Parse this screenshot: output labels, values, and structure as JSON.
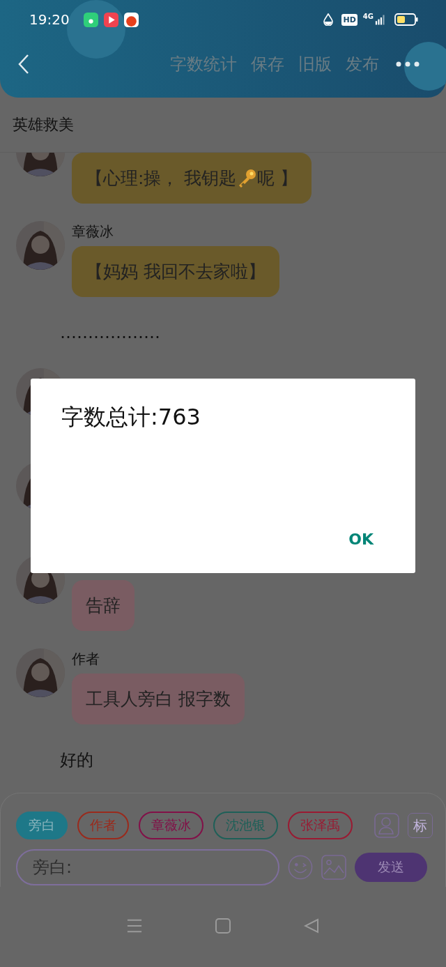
{
  "status_bar": {
    "time": "19:20",
    "hd": "HD",
    "network": "4G"
  },
  "header": {
    "actions": [
      "字数统计",
      "保存",
      "旧版",
      "发布"
    ]
  },
  "title": "英雄救美",
  "messages": [
    {
      "kind": "bubble",
      "color": "#6a5a2a",
      "segments": [
        {
          "kind": "text",
          "text": "【心理:操，  我钥匙"
        },
        {
          "kind": "key"
        },
        {
          "kind": "text",
          "text": "呢 】"
        }
      ]
    },
    {
      "kind": "bubble",
      "name": "章薇冰",
      "color": "#6a5a2a",
      "segments": [
        {
          "kind": "text",
          "text": "【妈妈 我回不去家啦】"
        }
      ]
    },
    {
      "kind": "narration",
      "text": "………………"
    },
    {
      "kind": "bubble"
    },
    {
      "kind": "bubble"
    },
    {
      "kind": "bubble",
      "color": "#7a5c62",
      "segments": [
        {
          "kind": "text",
          "text": "告辞"
        }
      ]
    },
    {
      "kind": "bubble",
      "name": "作者",
      "color": "#7a5c62",
      "segments": [
        {
          "kind": "text",
          "text": "工具人旁白 报字数"
        }
      ]
    },
    {
      "kind": "narration",
      "text": "好的"
    }
  ],
  "composer": {
    "roles": [
      {
        "label": "旁白",
        "selected": true,
        "color": "#1e7888"
      },
      {
        "label": "作者",
        "selected": false,
        "color": "#9a2a1c"
      },
      {
        "label": "章薇冰",
        "selected": false,
        "color": "#821048"
      },
      {
        "label": "沈池银",
        "selected": false,
        "color": "#1e6058"
      },
      {
        "label": "张泽禹",
        "selected": false,
        "color": "#9a1a32"
      }
    ],
    "mark_button": "标",
    "placeholder": "旁白:",
    "send": "发送"
  },
  "dialog": {
    "title": "字数总计:763",
    "button": "OK"
  }
}
